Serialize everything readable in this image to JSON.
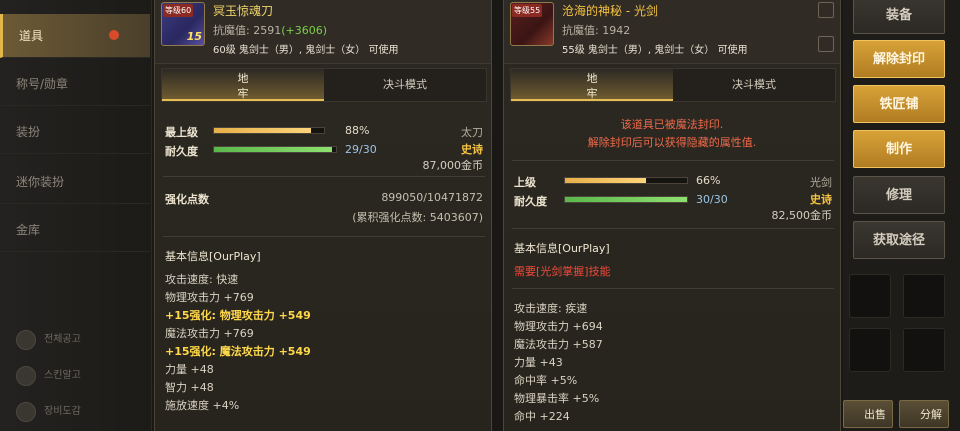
{
  "sidebar": {
    "items": [
      {
        "label": "道具"
      },
      {
        "label": "称号/勋章"
      },
      {
        "label": "装扮"
      },
      {
        "label": "迷你装扮"
      },
      {
        "label": "金库"
      }
    ],
    "bottom_links": [
      {
        "label": "전체공고"
      },
      {
        "label": "스킨알고"
      },
      {
        "label": "장비도감"
      }
    ]
  },
  "left_item": {
    "level_tag": "等级60",
    "enhance_tag": "15",
    "name": "冥玉惊魂刀",
    "resist_label": "抗魔值: 2591",
    "resist_bonus": "(+3606)",
    "requirement": "60级 鬼剑士（男）, 鬼剑士（女） 可使用",
    "tabs": {
      "dungeon": "地\n牢",
      "duel": "决斗模式"
    },
    "grade_label": "最上级",
    "grade_pct": "88%",
    "grade_value": 0.88,
    "durability_label": "耐久度",
    "durability_text": "29/30",
    "durability_value": 0.967,
    "weapon_type": "太刀",
    "rarity": "史诗",
    "price": "87,000金币",
    "enhance_label": "强化点数",
    "enhance_points": "899050/10471872",
    "enhance_total": "(累积强化点数: 5403607)",
    "section_title": "基本信息[OurPlay]",
    "stats": [
      {
        "text": "攻击速度: 快速",
        "enh": false
      },
      {
        "text": "物理攻击力 +769",
        "enh": false
      },
      {
        "text": "+15强化: 物理攻击力 +549",
        "enh": true
      },
      {
        "text": "魔法攻击力 +769",
        "enh": false
      },
      {
        "text": "+15强化: 魔法攻击力 +549",
        "enh": true
      },
      {
        "text": "力量 +48",
        "enh": false
      },
      {
        "text": "智力 +48",
        "enh": false
      },
      {
        "text": "施放速度 +4%",
        "enh": false
      }
    ]
  },
  "right_item": {
    "level_tag": "等级55",
    "name": "沧海的神秘 - 光剑",
    "resist_label": "抗魔值: 1942",
    "requirement": "55级 鬼剑士（男）, 鬼剑士（女） 可使用",
    "tabs": {
      "dungeon": "地\n牢",
      "duel": "决斗模式"
    },
    "sealed_line1": "该道具已被魔法封印.",
    "sealed_line2": "解除封印后可以获得隐藏的属性值.",
    "grade_label": "上级",
    "grade_pct": "66%",
    "grade_value": 0.66,
    "durability_label": "耐久度",
    "durability_text": "30/30",
    "durability_value": 1.0,
    "weapon_type": "光剑",
    "rarity": "史诗",
    "price": "82,500金币",
    "section_title": "基本信息[OurPlay]",
    "req_skill": "需要[光剑掌握]技能",
    "stats": [
      {
        "text": "攻击速度: 疾速"
      },
      {
        "text": "物理攻击力 +694"
      },
      {
        "text": "魔法攻击力 +587"
      },
      {
        "text": "力量 +43"
      },
      {
        "text": "命中率 +5%"
      },
      {
        "text": "物理暴击率 +5%"
      },
      {
        "text": "命中 +224"
      }
    ]
  },
  "actions": {
    "equip": "装备",
    "unseal": "解除封印",
    "blacksmith": "铁匠铺",
    "craft": "制作",
    "repair": "修理",
    "obtain": "获取途径",
    "sell": "出售",
    "disassemble": "分解"
  },
  "colors": {
    "accent_gold": "#d8a238",
    "epic": "#f5c242",
    "enhance": "#ffd84a",
    "sealed_red": "#f06a4a",
    "bonus_green": "#7ad04a"
  }
}
